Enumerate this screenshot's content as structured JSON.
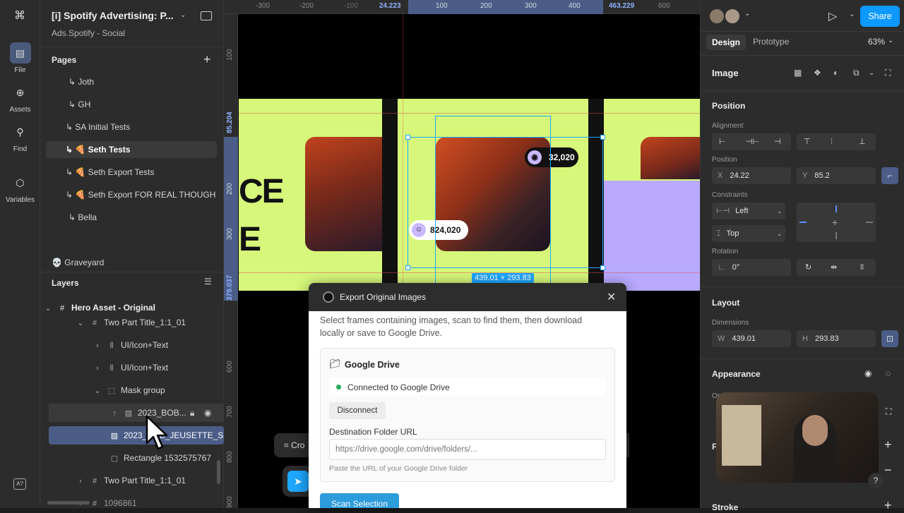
{
  "rail": {
    "items": [
      {
        "label": "File",
        "icon": "file-icon"
      },
      {
        "label": "Assets",
        "icon": "assets-icon"
      },
      {
        "label": "Find",
        "icon": "search-icon"
      },
      {
        "label": "Variables",
        "icon": "variables-icon"
      }
    ]
  },
  "file": {
    "title": "[i] Spotify Advertising: P...",
    "subtitle": "Ads.Spotify - Social"
  },
  "pages": {
    "heading": "Pages",
    "items": [
      {
        "label": "↳ Joth"
      },
      {
        "label": "↳ GH"
      },
      {
        "label": "↳ SA Initial Tests"
      },
      {
        "label": "↳ 🍕 Seth Tests"
      },
      {
        "label": "↳ 🍕 Seth Export Tests"
      },
      {
        "label": "↳ 🍕 Seth Export FOR REAL THOUGH"
      },
      {
        "label": "↳ Bella"
      },
      {
        "label": "💀 Graveyard"
      }
    ]
  },
  "layers": {
    "heading": "Layers",
    "items": [
      {
        "label": "Hero Asset - Original"
      },
      {
        "label": "Two Part Title_1:1_01"
      },
      {
        "label": "UI/Icon+Text"
      },
      {
        "label": "UI/Icon+Text"
      },
      {
        "label": "Mask group"
      },
      {
        "label": "2023_BOB..."
      },
      {
        "label": "2023_BOB_JEUSETTE_S"
      },
      {
        "label": "Rectangle 1532575767"
      },
      {
        "label": "Two Part Title_1:1_01"
      },
      {
        "label": "1096861"
      }
    ]
  },
  "ruler": {
    "top": [
      "-300",
      "-200",
      "-100",
      "24.223",
      "100",
      "200",
      "300",
      "400",
      "463.229",
      "600"
    ],
    "left": [
      "100",
      "85.204",
      "200",
      "300",
      "379.037",
      "600",
      "700",
      "800",
      "900"
    ]
  },
  "canvas": {
    "badge_top": "32,020",
    "badge_bottom": "824,020",
    "heading_fragment_1": "CE",
    "heading_fragment_2": "E",
    "selection_size": "439.01 × 293.83",
    "crop_label": "Cro"
  },
  "dialog": {
    "title": "Export Original Images",
    "description": "Select frames containing images, scan to find them, then download locally or save to Google Drive.",
    "card_title": "Google Drive",
    "status": "Connected to Google Drive",
    "disconnect": "Disconnect",
    "folder_label": "Destination Folder URL",
    "folder_placeholder": "https://drive.google.com/drive/folders/...",
    "folder_help": "Paste the URL of your Google Drive folder",
    "scan_button": "Scan Selection",
    "colors": {
      "accent": "#2d9cdb",
      "status_dot": "#27ae60"
    }
  },
  "right": {
    "share": "Share",
    "tabs": [
      "Design",
      "Prototype"
    ],
    "zoom": "63%",
    "element_type": "Image",
    "position_heading": "Position",
    "alignment_label": "Alignment",
    "position_label": "Position",
    "x_key": "X",
    "x_val": "24.22",
    "y_key": "Y",
    "y_val": "85.2",
    "constraints_label": "Constraints",
    "constraint_h": "Left",
    "constraint_v": "Top",
    "rotation_label": "Rotation",
    "rotation_val": "0°",
    "layout_heading": "Layout",
    "dimensions_label": "Dimensions",
    "w_key": "W",
    "w_val": "439.01",
    "h_key": "H",
    "h_val": "293.83",
    "appearance_heading": "Appearance",
    "opacity_label": "Opac",
    "fill_label": "F",
    "stroke_heading": "Stroke",
    "help": "?"
  }
}
